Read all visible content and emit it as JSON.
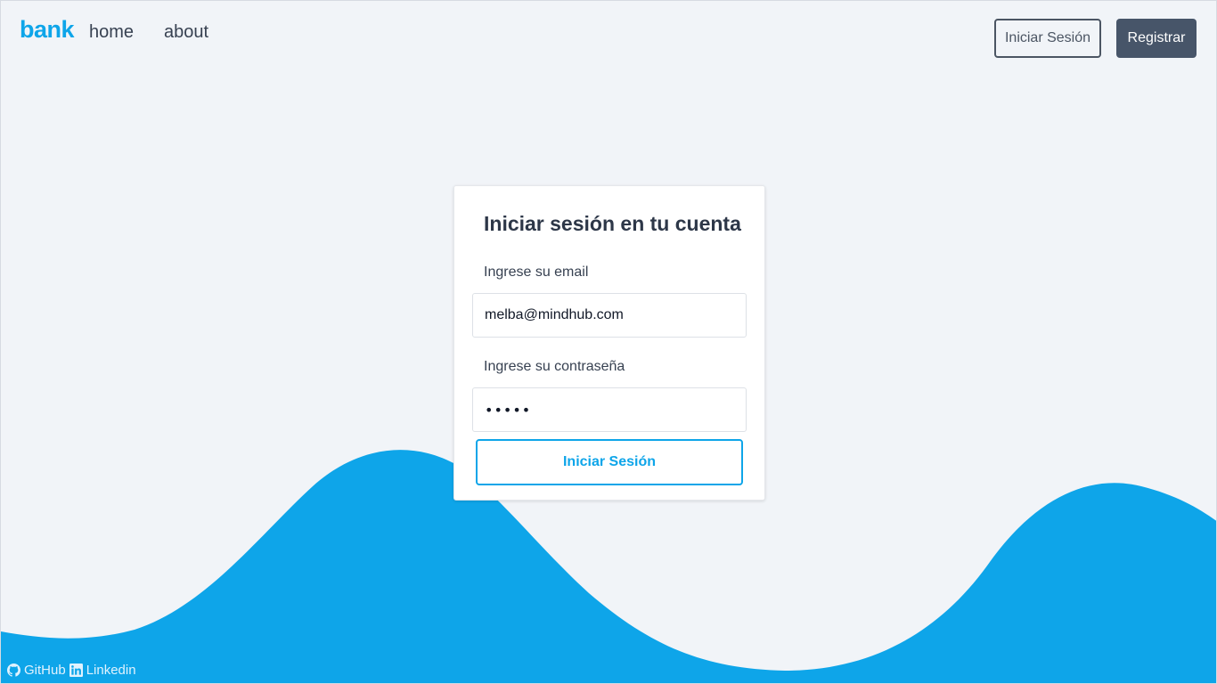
{
  "header": {
    "logo": "bank",
    "nav": {
      "home": "home",
      "about": "about"
    },
    "login_button": "Iniciar Sesión",
    "register_button": "Registrar"
  },
  "login_card": {
    "title": "Iniciar sesión en tu cuenta",
    "email_label": "Ingrese su email",
    "email_value": "melba@mindhub.com",
    "password_label": "Ingrese su contraseña",
    "password_value": "•••••",
    "submit_button": "Iniciar Sesión"
  },
  "footer": {
    "github_label": "GitHub",
    "linkedin_label": "Linkedin",
    "github_icon": "github-icon",
    "linkedin_icon": "linkedin-icon"
  },
  "colors": {
    "accent": "#0ea5e9",
    "wave": "#0ea5e9",
    "background": "#f1f4f8",
    "dark_button": "#475569"
  }
}
